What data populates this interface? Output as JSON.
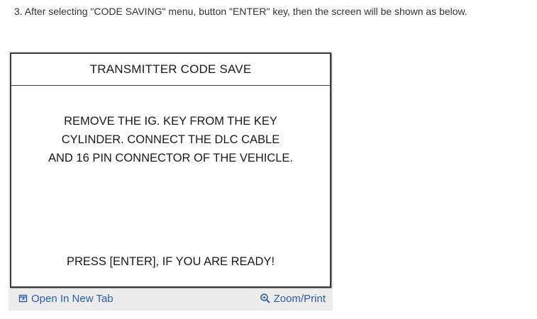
{
  "instruction": "3. After selecting \"CODE SAVING\" menu, button \"ENTER\" key, then the screen will be shown as below.",
  "screen": {
    "title": "TRANSMITTER CODE SAVE",
    "message_lines": [
      "REMOVE THE IG. KEY FROM THE KEY",
      "CYLINDER. CONNECT THE DLC CABLE",
      "AND 16 PIN CONNECTOR OF THE VEHICLE."
    ],
    "prompt": "PRESS [ENTER], IF YOU ARE READY!"
  },
  "footer": {
    "open_tab_label": "Open In New Tab",
    "open_tab_icon": "open-new-tab-icon",
    "zoom_label": "Zoom/Print",
    "zoom_icon": "zoom-icon",
    "link_color": "#2a5db0"
  }
}
